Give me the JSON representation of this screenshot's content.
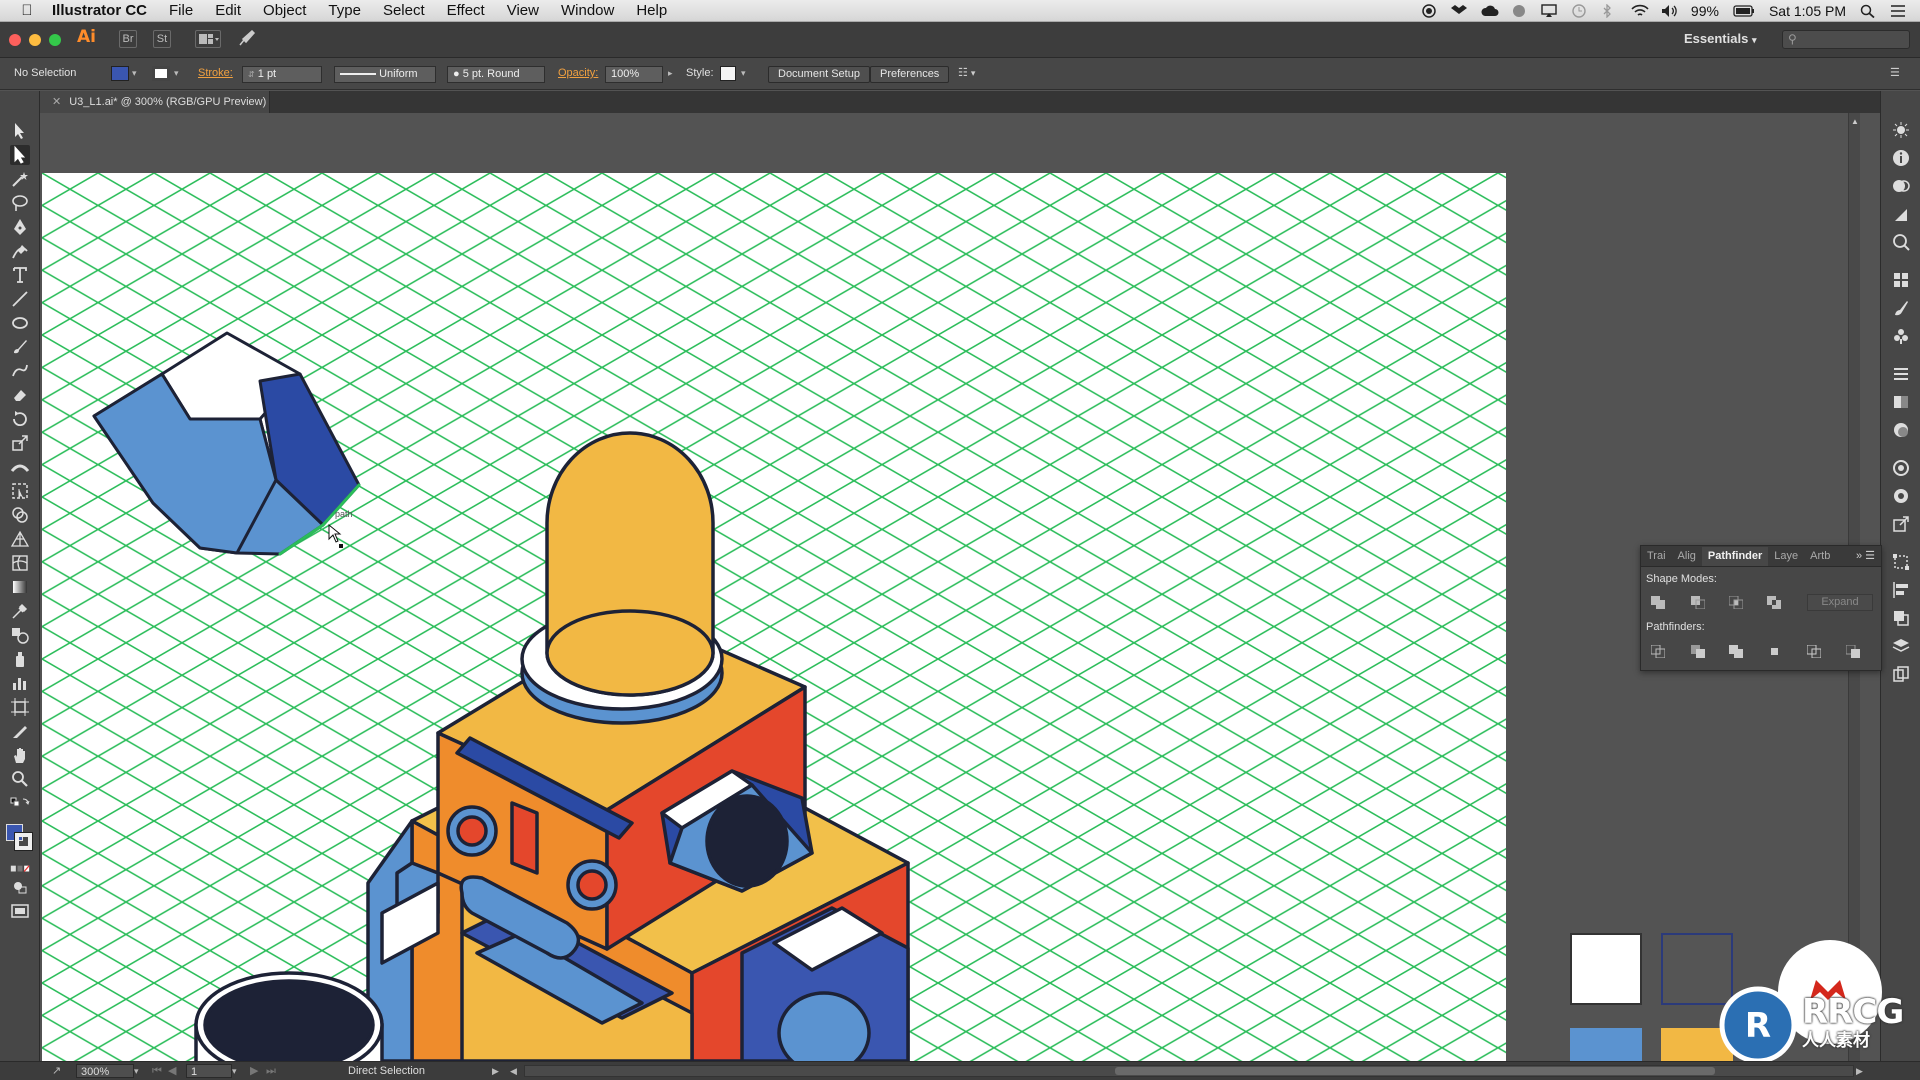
{
  "menubar": {
    "apple_icon": "apple-icon",
    "app_name": "Illustrator CC",
    "items": [
      "File",
      "Edit",
      "Object",
      "Type",
      "Select",
      "Effect",
      "View",
      "Window",
      "Help"
    ],
    "battery": "99%",
    "clock": "Sat 1:05 PM"
  },
  "appbar": {
    "logo": "Ai",
    "bridge_label": "Br",
    "stock_label": "St",
    "workspace": "Essentials",
    "search_placeholder": ""
  },
  "controlbar": {
    "selection_status": "No Selection",
    "stroke_label": "Stroke:",
    "stroke_weight": "1 pt",
    "stroke_profile": "Uniform",
    "brush": "5 pt. Round",
    "opacity_label": "Opacity:",
    "opacity_value": "100%",
    "style_label": "Style:",
    "document_setup": "Document Setup",
    "preferences": "Preferences"
  },
  "document": {
    "tab_title": "U3_L1.ai* @ 300% (RGB/GPU Preview)"
  },
  "pathfinder": {
    "tabs": [
      "Trai",
      "Alig",
      "Pathfinder",
      "Laye",
      "Artb"
    ],
    "active_tab": "Pathfinder",
    "shape_modes_label": "Shape Modes:",
    "pathfinders_label": "Pathfinders:",
    "expand_label": "Expand"
  },
  "statusbar": {
    "zoom": "300%",
    "artboard_number": "1",
    "current_tool": "Direct Selection"
  },
  "canvas": {
    "cursor_hint": "path"
  },
  "watermark": {
    "logo_text": "RRCG",
    "logo_subtext": "人人素材",
    "corner_text": "RRCG"
  },
  "colors": {
    "accent_orange": "#f0a040",
    "grid_green": "#2bbd5a",
    "robot_yellow": "#f2b844",
    "robot_orange": "#ef8c2c",
    "robot_red": "#e4472c",
    "robot_blue": "#3a56b0",
    "robot_light_blue": "#5b93d0",
    "outline": "#1d2236"
  }
}
